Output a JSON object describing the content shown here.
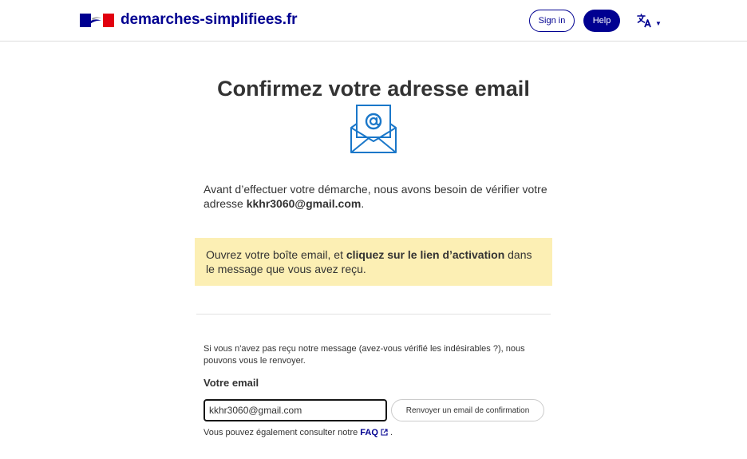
{
  "header": {
    "site_name": "demarches-simplifiees.fr",
    "sign_in_label": "Sign in",
    "help_label": "Help",
    "language_icon": "translate-icon"
  },
  "main": {
    "title": "Confirmez votre adresse email",
    "illustration": "envelope-at-icon",
    "intro_before": "Avant d’effectuer votre démarche, nous avons besoin de vérifier votre adresse ",
    "intro_email": "kkhr3060@gmail.com",
    "intro_after": ".",
    "notice_before": "Ouvrez votre boîte email, et ",
    "notice_bold": "cliquez sur le lien d’activation",
    "notice_after": " dans le message que vous avez reçu."
  },
  "resend": {
    "text": "Si vous n'avez pas reçu notre message (avez-vous vérifié les indésirables ?), nous pouvons vous le renvoyer.",
    "email_label": "Votre email",
    "email_value": "kkhr3060@gmail.com",
    "button_label": "Renvoyer un email de confirmation",
    "faq_before": "Vous pouvez également consulter notre ",
    "faq_link": "FAQ",
    "faq_after": " ."
  },
  "colors": {
    "brand_blue": "#000091",
    "notice_background": "#fcefb4",
    "envelope_blue": "#1a77c9"
  }
}
